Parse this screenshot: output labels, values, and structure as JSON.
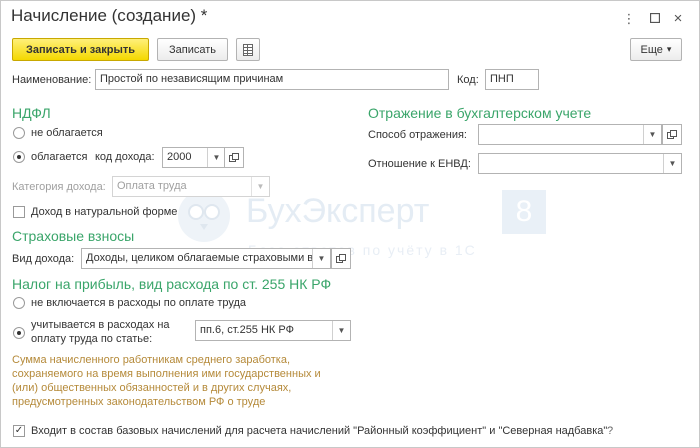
{
  "window": {
    "title": "Начисление (создание) *",
    "more_icon": "kebab-vertical-icon",
    "maximize_icon": "maximize-icon",
    "close_icon": "close-icon"
  },
  "toolbar": {
    "save_close_label": "Записать и закрыть",
    "save_label": "Записать",
    "table_icon": "spreadsheet-icon",
    "more_label": "Еще",
    "more_chevron": "▾"
  },
  "name_field": {
    "label": "Наименование:",
    "value": "Простой по независящим причинам"
  },
  "code_field": {
    "label": "Код:",
    "value": "ПНП"
  },
  "ndfl": {
    "title": "НДФЛ",
    "not_taxed_label": "не облагается",
    "taxed_label": "облагается",
    "income_code_label": "код дохода:",
    "income_code_value": "2000",
    "income_category_label": "Категория дохода:",
    "income_category_value": "Оплата труда",
    "in_kind_label": "Доход в натуральной форме"
  },
  "accounting": {
    "title": "Отражение в бухгалтерском учете",
    "method_label": "Способ отражения:",
    "method_value": "",
    "envd_label": "Отношение к ЕНВД:",
    "envd_value": ""
  },
  "insurance": {
    "title": "Страховые взносы",
    "income_type_label": "Вид дохода:",
    "income_type_value": "Доходы, целиком облагаемые страховыми в"
  },
  "profit_tax": {
    "title": "Налог на прибыль, вид расхода по ст. 255 НК РФ",
    "not_included_label": "не включается в расходы по оплате труда",
    "included_label_1": "учитывается в расходах на",
    "included_label_2": "оплату труда по статье:",
    "article_value": "пп.6, ст.255 НК РФ",
    "note_lines": [
      "Сумма начисленного работникам среднего заработка,",
      "сохраняемого на время выполнения ими государственных и",
      "(или) общественных обязанностей и в других случаях,",
      "предусмотренных законодательством РФ о труде"
    ]
  },
  "base_accruals": {
    "label": "Входит в состав базовых начислений для расчета начислений \"Районный коэффициент\" и \"Северная надбавка\"",
    "checked": true,
    "help": "?"
  },
  "watermark": {
    "brand": "БухЭксперт",
    "number": "8",
    "subtitle": "База ответов по учёту в 1С"
  }
}
